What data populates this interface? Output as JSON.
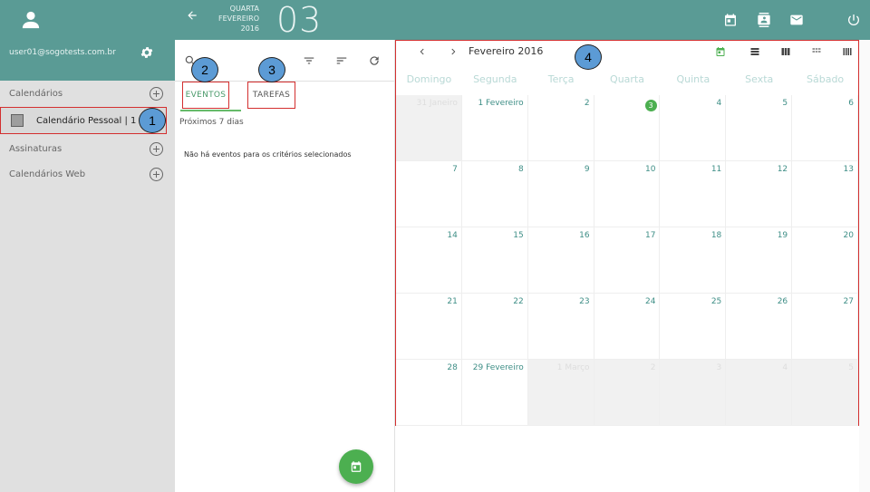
{
  "sidebar": {
    "email": "user01@sogotests.com.br",
    "sections": [
      {
        "label": "Calendários"
      },
      {
        "label": "Assinaturas"
      },
      {
        "label": "Calendários Web"
      }
    ],
    "calendar_item": {
      "label": "Calendário Pessoal | 1"
    }
  },
  "header": {
    "weekday": "QUARTA",
    "month": "FEVEREIRO",
    "year": "2016",
    "day": "03"
  },
  "list": {
    "tabs": [
      {
        "label": "EVENTOS"
      },
      {
        "label": "TAREFAS"
      }
    ],
    "range_label": "Próximos 7 dias",
    "empty_message": "Não há eventos para os critérios selecionados"
  },
  "calendar": {
    "month_title": "Fevereiro 2016",
    "weekdays": [
      "Domingo",
      "Segunda",
      "Terça",
      "Quarta",
      "Quinta",
      "Sexta",
      "Sábado"
    ],
    "weeks": [
      [
        {
          "t": "31 Janeiro",
          "out": true
        },
        {
          "t": "1 Fevereiro"
        },
        {
          "t": "2"
        },
        {
          "t": "3",
          "today": true
        },
        {
          "t": "4"
        },
        {
          "t": "5"
        },
        {
          "t": "6"
        }
      ],
      [
        {
          "t": "7"
        },
        {
          "t": "8"
        },
        {
          "t": "9"
        },
        {
          "t": "10"
        },
        {
          "t": "11"
        },
        {
          "t": "12"
        },
        {
          "t": "13"
        }
      ],
      [
        {
          "t": "14"
        },
        {
          "t": "15"
        },
        {
          "t": "16"
        },
        {
          "t": "17"
        },
        {
          "t": "18"
        },
        {
          "t": "19"
        },
        {
          "t": "20"
        }
      ],
      [
        {
          "t": "21"
        },
        {
          "t": "22"
        },
        {
          "t": "23"
        },
        {
          "t": "24"
        },
        {
          "t": "25"
        },
        {
          "t": "26"
        },
        {
          "t": "27"
        }
      ],
      [
        {
          "t": "28"
        },
        {
          "t": "29 Fevereiro"
        },
        {
          "t": "1 Março",
          "out": true
        },
        {
          "t": "2",
          "out": true
        },
        {
          "t": "3",
          "out": true
        },
        {
          "t": "4",
          "out": true
        },
        {
          "t": "5",
          "out": true
        }
      ]
    ]
  },
  "markers": [
    "1",
    "2",
    "3",
    "4"
  ],
  "colors": {
    "accent": "#5a9b95",
    "green": "#4caf50",
    "highlight": "#d32f2f",
    "marker": "#5c9bd5"
  }
}
